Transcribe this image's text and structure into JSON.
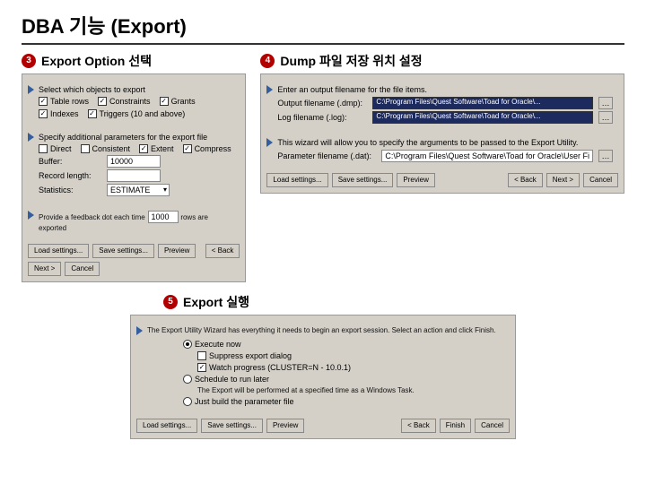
{
  "title": "DBA 기능 (Export)",
  "sections": {
    "s3": {
      "num": "3",
      "title": "Export Option 선택"
    },
    "s4": {
      "num": "4",
      "title": "Dump 파일 저장 위치 설정"
    },
    "s5": {
      "num": "5",
      "title": "Export 실행"
    }
  },
  "panel3": {
    "g1_head": "Select which objects to export",
    "cb_tablerows": "Table rows",
    "cb_constraints": "Constraints",
    "cb_grants": "Grants",
    "cb_indexes": "Indexes",
    "cb_triggers": "Triggers (10 and above)",
    "g2_head": "Specify additional parameters for the export file",
    "cb_direct": "Direct",
    "cb_consistent": "Consistent",
    "cb_extent": "Extent",
    "cb_compress": "Compress",
    "lbl_buffer": "Buffer:",
    "val_buffer": "10000",
    "lbl_reclen": "Record length:",
    "val_reclen": "",
    "lbl_stats": "Statistics:",
    "val_stats": "ESTIMATE",
    "feedback_pre": "Provide a feedback dot each time",
    "val_feedback": "1000",
    "feedback_post": "rows are exported"
  },
  "panel4": {
    "g1_head": "Enter an output filename for the file items.",
    "lbl_out": "Output filename (.dmp):",
    "lbl_log": "Log filename (.log):",
    "val_path": "C:\\Program Files\\Quest Software\\Toad for Oracle\\...",
    "g2_head": "This wizard will allow you to specify the arguments to be passed to the Export Utility.",
    "lbl_param": "Parameter filename (.dat):",
    "val_param": "C:\\Program Files\\Quest Software\\Toad for Oracle\\User Fi"
  },
  "panel5": {
    "intro": "The Export Utility Wizard has everything it needs to begin an export session.  Select an action and click Finish.",
    "rb_exec": "Execute now",
    "cb_suppress": "Suppress export dialog",
    "cb_watch": "Watch progress (CLUSTER=N - 10.0.1)",
    "rb_sched": "Schedule to run later",
    "sched_note": "The Export will be performed at a specified time as a Windows Task.",
    "rb_build": "Just build the parameter file"
  },
  "btns": {
    "load": "Load settings...",
    "save": "Save settings...",
    "preview": "Preview",
    "back": "< Back",
    "next": "Next >",
    "cancel": "Cancel",
    "finish": "Finish"
  }
}
